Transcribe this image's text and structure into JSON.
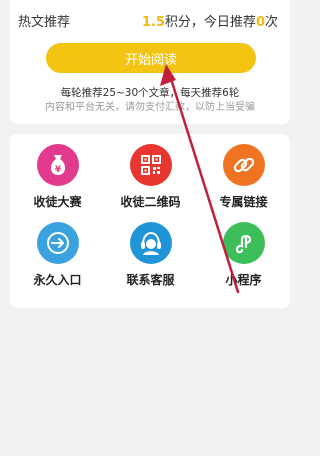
{
  "header": {
    "title": "热文推荐",
    "points_value": "1.5",
    "points_suffix": "积分，今日推荐",
    "today_count": "0",
    "count_suffix": "次"
  },
  "start_button": {
    "label": "开始阅读"
  },
  "info": {
    "line1": "每轮推荐25~30个文章，每天推荐6轮",
    "line2": "内容和平台无关，请勿支付汇款，以防上当受骗"
  },
  "grid": {
    "items": [
      {
        "label": "收徒大赛",
        "icon": "money-bag-icon",
        "color": "#e23b8d"
      },
      {
        "label": "收徒二维码",
        "icon": "qr-code-icon",
        "color": "#e8352f"
      },
      {
        "label": "专属链接",
        "icon": "link-icon",
        "color": "#f07321"
      },
      {
        "label": "永久入口",
        "icon": "entrance-icon",
        "color": "#3aa3df"
      },
      {
        "label": "联系客服",
        "icon": "customer-service-icon",
        "color": "#1f95d8"
      },
      {
        "label": "小程序",
        "icon": "mini-program-icon",
        "color": "#3cbf5a"
      }
    ]
  },
  "colors": {
    "accent": "#f3c412",
    "highlight": "#f2b90f",
    "annotation_arrow": "#c0203a"
  }
}
